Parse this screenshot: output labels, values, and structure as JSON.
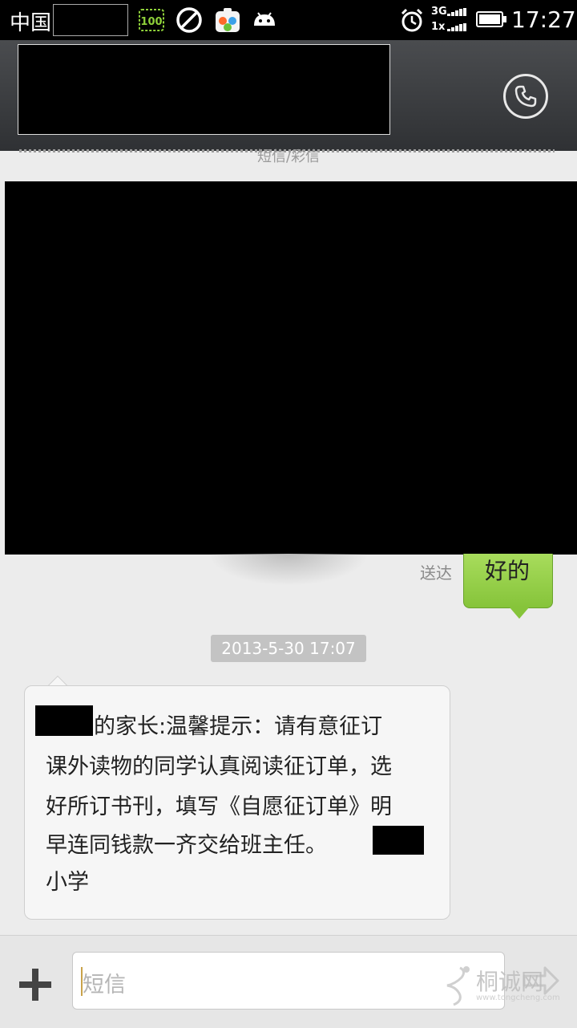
{
  "status_bar": {
    "carrier": "中国",
    "network_top": "3G",
    "network_bottom": "1x",
    "time": "17:27",
    "notification_icons": [
      "battery-100-icon",
      "no-disturb-icon",
      "app-store-icon",
      "android-icon"
    ]
  },
  "header": {
    "sms_type": "短信/彩信",
    "call_icon": "phone-icon"
  },
  "messages": {
    "sent": {
      "status": "送达",
      "text": "好的"
    },
    "timestamp": "2013-5-30 17:07",
    "received": {
      "lines": [
        "的家长:温馨提示：请有意征订",
        "课外读物的同学认真阅读征订单，选",
        "好所订书刊，填写《自愿征订单》明",
        "早连同钱款一齐交给班主任。",
        "小学"
      ]
    }
  },
  "compose": {
    "placeholder": "短信",
    "add_icon": "plus-icon",
    "send_icon": "send-icon"
  },
  "watermark": {
    "text": "桐诚网",
    "url": "www.tongcheng.com"
  },
  "colors": {
    "sent_bubble": "#86c43a",
    "status_bar": "#000000",
    "title_bar": "#3c3e41",
    "background": "#ececec"
  }
}
